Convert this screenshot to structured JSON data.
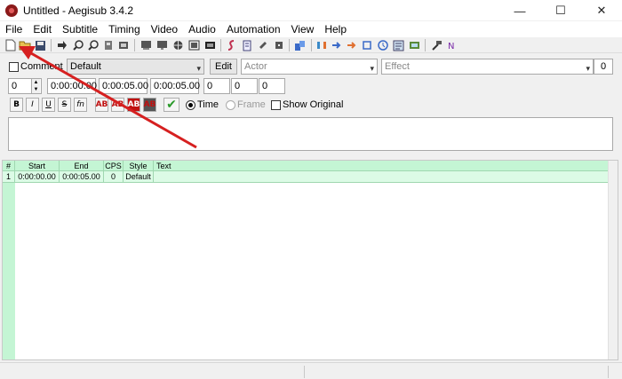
{
  "window": {
    "title": "Untitled - Aegisub 3.4.2",
    "controls": {
      "minimize": "—",
      "maximize": "☐",
      "close": "✕"
    }
  },
  "menu": [
    "File",
    "Edit",
    "Subtitle",
    "Timing",
    "Video",
    "Audio",
    "Automation",
    "View",
    "Help"
  ],
  "toolbar": {
    "icons": [
      "new-file-icon",
      "open-folder-icon",
      "save-icon",
      "jump-to-icon",
      "zoom-in-icon",
      "zoom-out-icon",
      "open-audio-icon",
      "open-video-icon",
      "video-detach-icon",
      "keyframe-icon",
      "video-frame-icon",
      "styles-manager-icon",
      "properties-icon",
      "attachments-icon",
      "fonts-collector-icon",
      "automation-icon",
      "timing-postprocess-icon",
      "shift-times-icon",
      "translation-icon",
      "resample-icon",
      "timing-assist-icon",
      "kanji-timer-icon",
      "spell-check-icon",
      "options-icon",
      "macro-icon"
    ],
    "annotation_color": "#d62020"
  },
  "edit": {
    "comment_label": "Comment",
    "style_value": "Default",
    "edit_button": "Edit",
    "actor_placeholder": "Actor",
    "effect_placeholder": "Effect",
    "effect_count": "0",
    "layer_value": "0",
    "start_time": "0:00:00.00",
    "end_time": "0:00:05.00",
    "duration": "0:00:05.00",
    "margin_left": "0",
    "margin_right": "0",
    "margin_vertical": "0",
    "format_buttons": [
      "B",
      "I",
      "U",
      "S",
      "fn",
      "AB",
      "AB",
      "AB",
      "AB"
    ],
    "commit_icon": "checkmark-icon",
    "time_label": "Time",
    "frame_label": "Frame",
    "show_original_label": "Show Original"
  },
  "grid": {
    "columns": [
      "#",
      "Start",
      "End",
      "CPS",
      "Style",
      "Text"
    ],
    "rows": [
      {
        "num": "1",
        "start": "0:00:00.00",
        "end": "0:00:05.00",
        "cps": "0",
        "style": "Default",
        "text": ""
      }
    ],
    "header_color": "#c4f5d4",
    "row_color": "#dcfbe6"
  }
}
